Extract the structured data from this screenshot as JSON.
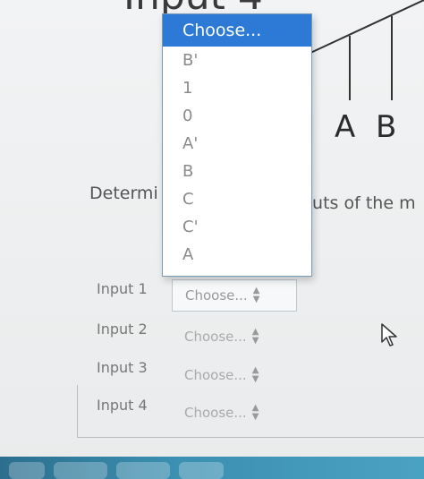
{
  "header": {
    "partial_title": "Input 4"
  },
  "diagram": {
    "label_a": "A",
    "label_b": "B"
  },
  "description": {
    "left_fragment": "Determi",
    "right_fragment": "puts of the m"
  },
  "dropdown": {
    "options": [
      "Choose...",
      "B'",
      "1",
      "0",
      "A'",
      "B",
      "C",
      "C'",
      "A"
    ],
    "highlighted_index": 0
  },
  "inputs": [
    {
      "label": "Input 1",
      "value": "Choose..."
    },
    {
      "label": "Input 2",
      "value": "Choose..."
    },
    {
      "label": "Input 3",
      "value": "Choose..."
    },
    {
      "label": "Input 4",
      "value": "Choose..."
    }
  ]
}
